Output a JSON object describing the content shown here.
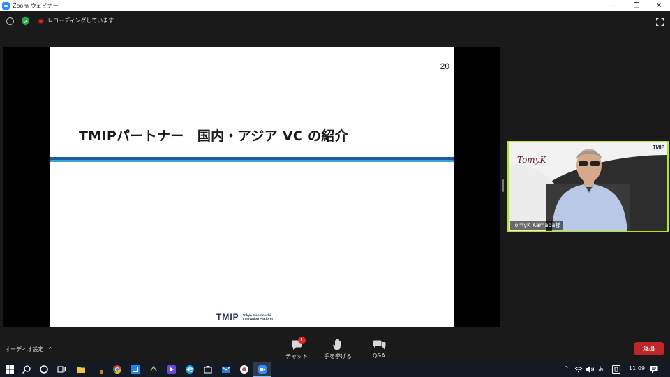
{
  "window": {
    "title": "Zoom ウェビナー",
    "controls": [
      "—",
      "❐",
      "✕"
    ]
  },
  "topbar": {
    "recording_text": "レコーディングしています"
  },
  "slide": {
    "page_number": "20",
    "title": "TMIPパートナー　国内・アジア VC の紹介",
    "footer_logo": "TMIP",
    "footer_sub_line1": "Tokyo Marunouchi",
    "footer_sub_line2": "Innovation Platform"
  },
  "video": {
    "participant_name": "TomyK Kamada様",
    "brand_script": "TomyK",
    "brand_logo": "TMIP"
  },
  "controls": {
    "audio_settings": "オーディオ設定",
    "chat_label": "チャット",
    "chat_badge": "1",
    "raise_hand_label": "手を挙げる",
    "qa_label": "Q&A",
    "leave_label": "退出"
  },
  "taskbar": {
    "ime": "あ",
    "clock": "11:09"
  },
  "colors": {
    "video_border": "#b5e61d",
    "leave_button": "#c0252a",
    "recording_dot": "#e02828",
    "shield": "#23a94b",
    "slide_rule_dark": "#1f5a9f",
    "slide_rule_light": "#3aa5d9"
  }
}
